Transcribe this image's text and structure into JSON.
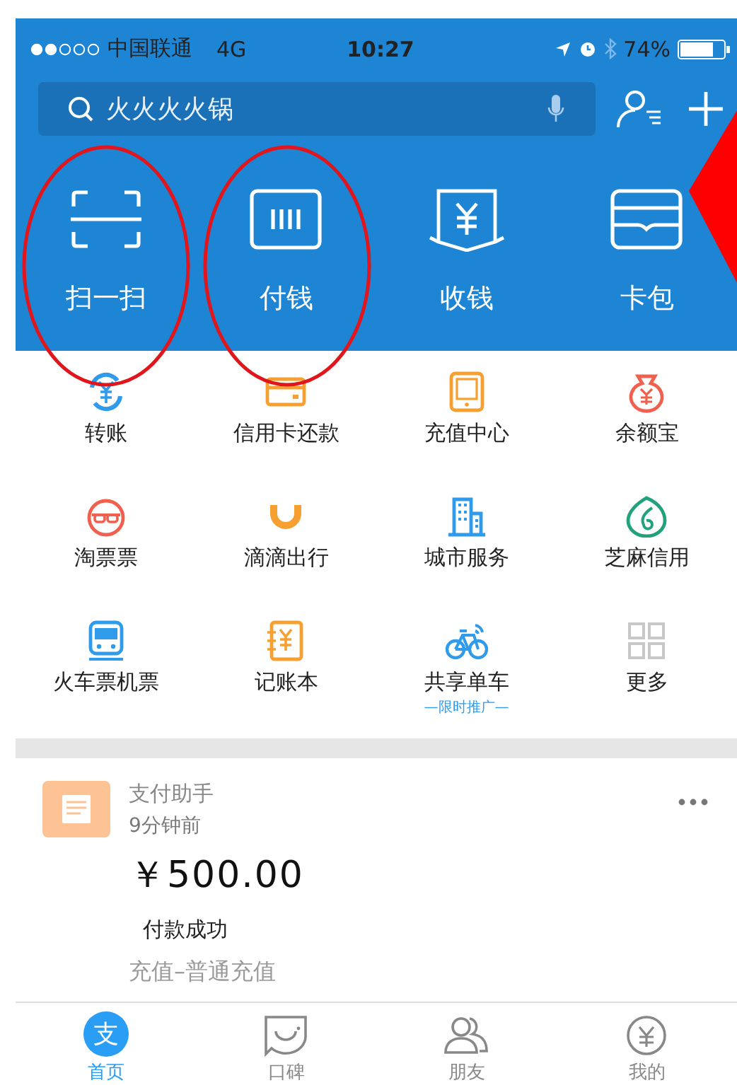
{
  "status_bar": {
    "carrier": "中国联通",
    "network": "4G",
    "time": "10:27",
    "battery": "74%"
  },
  "search": {
    "placeholder": "火火火火锅"
  },
  "quick_actions": [
    {
      "label": "扫一扫",
      "kind": "scan"
    },
    {
      "label": "付钱",
      "kind": "pay"
    },
    {
      "label": "收钱",
      "kind": "receive"
    },
    {
      "label": "卡包",
      "kind": "wallet"
    }
  ],
  "services": [
    {
      "label": "转账",
      "kind": "transfer",
      "color": "#2f9bea"
    },
    {
      "label": "信用卡还款",
      "kind": "card",
      "color": "#f5a031"
    },
    {
      "label": "充值中心",
      "kind": "phone",
      "color": "#f5a031"
    },
    {
      "label": "余额宝",
      "kind": "bag",
      "color": "#f0604f"
    },
    {
      "label": "淘票票",
      "kind": "face",
      "color": "#f0604f"
    },
    {
      "label": "滴滴出行",
      "kind": "cup",
      "color": "#f5a031"
    },
    {
      "label": "城市服务",
      "kind": "building",
      "color": "#2f9bea"
    },
    {
      "label": "芝麻信用",
      "kind": "seed",
      "color": "#22a27c"
    },
    {
      "label": "火车票机票",
      "kind": "train",
      "color": "#2f9bea"
    },
    {
      "label": "记账本",
      "kind": "book",
      "color": "#f5a031"
    },
    {
      "label": "共享单车",
      "kind": "bike",
      "color": "#2f9bea",
      "note": "—限时推广—"
    },
    {
      "label": "更多",
      "kind": "more",
      "color": "#c8c8c8"
    }
  ],
  "message": {
    "sender": "支付助手",
    "time": "9分钟前",
    "amount": "￥500.00",
    "status": "付款成功",
    "detail": "充值–普通充值"
  },
  "tabs": [
    {
      "label": "首页",
      "kind": "home",
      "icon_text": "支",
      "selected": true
    },
    {
      "label": "口碑",
      "kind": "koubei",
      "selected": false
    },
    {
      "label": "朋友",
      "kind": "friends",
      "selected": false
    },
    {
      "label": "我的",
      "kind": "mine",
      "selected": false
    }
  ],
  "annotations": [
    {
      "kind": "oval"
    },
    {
      "kind": "oval"
    },
    {
      "kind": "arrow"
    }
  ]
}
